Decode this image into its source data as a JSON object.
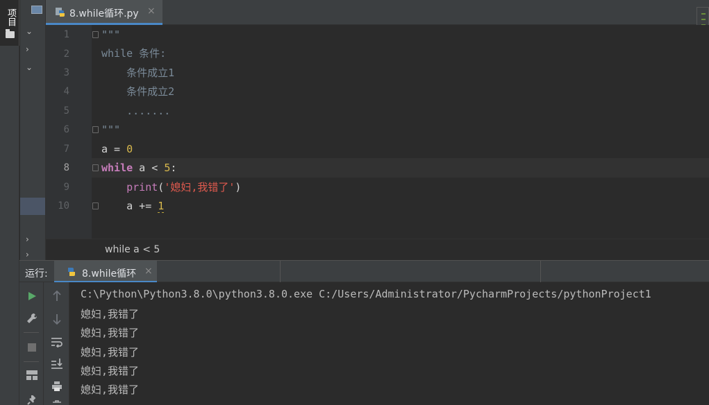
{
  "left_strip": {
    "project_label": "项目"
  },
  "editor_tab": {
    "filename": "8.while循环.py",
    "close": "×"
  },
  "editor": {
    "line_numbers": [
      "1",
      "2",
      "3",
      "4",
      "5",
      "6",
      "7",
      "8",
      "9",
      "10"
    ],
    "current_line": "8",
    "lines": {
      "l1": "\"\"\"",
      "l2": "while 条件:",
      "l3": "    条件成立1",
      "l4": "    条件成立2",
      "l5": "    .......",
      "l6": "\"\"\"",
      "l7_a": "a = ",
      "l7_b": "0",
      "l8_kw": "while",
      "l8_a": " a < ",
      "l8_b": "5",
      "l8_c": ":",
      "l9_pre": "    ",
      "l9_fn": "print",
      "l9_p1": "(",
      "l9_str": "'媳妇,我错了'",
      "l9_p2": ")",
      "l10_a": "    a += ",
      "l10_b": "1"
    }
  },
  "breadcrumb": "while a < 5",
  "run_panel": {
    "title": "运行:",
    "tab_label": "8.while循环",
    "tab_close": "×",
    "console_lines": [
      "C:\\Python\\Python3.8.0\\python3.8.0.exe C:/Users/Administrator/PycharmProjects/pythonProject1",
      "媳妇,我错了",
      "媳妇,我错了",
      "媳妇,我错了",
      "媳妇,我错了",
      "媳妇,我错了"
    ]
  },
  "colors": {
    "keyword": "#cc7832",
    "number": "#d9b94d",
    "string": "#e05a4e",
    "builtin": "#c77dbb",
    "accent": "#4a88c7",
    "run_green": "#59a869"
  }
}
